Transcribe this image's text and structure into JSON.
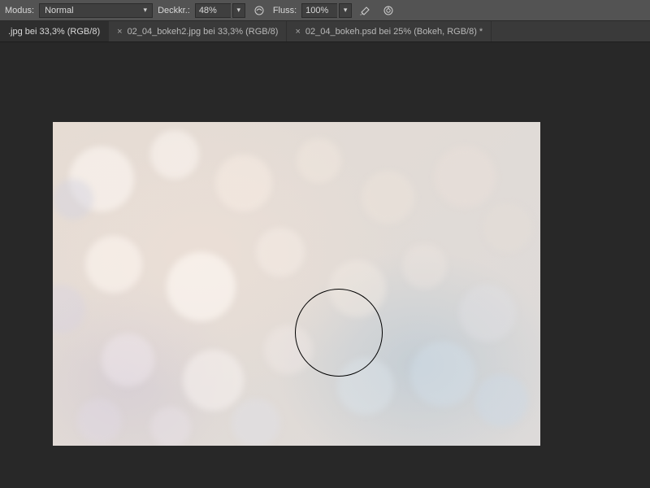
{
  "options": {
    "mode_label": "Modus:",
    "mode_value": "Normal",
    "opacity_label": "Deckkr.:",
    "opacity_value": "48%",
    "flow_label": "Fluss:",
    "flow_value": "100%"
  },
  "tabs": [
    {
      "label": ".jpg bei 33,3% (RGB/8)",
      "closable": false
    },
    {
      "label": "02_04_bokeh2.jpg bei 33,3% (RGB/8)",
      "closable": true
    },
    {
      "label": "02_04_bokeh.psd bei 25% (Bokeh, RGB/8) *",
      "closable": true
    }
  ]
}
